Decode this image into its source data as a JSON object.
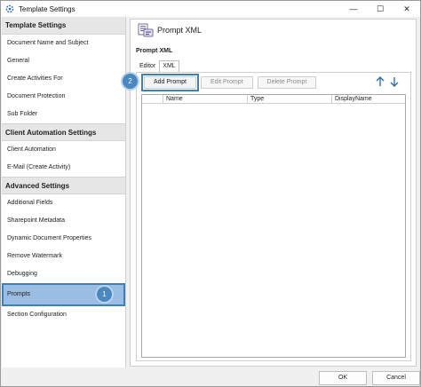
{
  "window": {
    "title": "Template Settings",
    "minimize": "—",
    "maximize": "☐",
    "close": "✕"
  },
  "sidebar": {
    "template_settings": {
      "header": "Template Settings",
      "items": [
        "Document Name and Subject",
        "General",
        "Create Activities For",
        "Document Protection",
        "Sub Folder"
      ]
    },
    "client_automation": {
      "header": "Client Automation Settings",
      "items": [
        "Client Automation",
        "E-Mail (Create Activity)"
      ]
    },
    "advanced": {
      "header": "Advanced Settings",
      "items": [
        "Additional Fields",
        "Sharepoint Metadata",
        "Dynamic Document Properties",
        "Remove Watermark",
        "Debugging",
        "Prompts",
        "Section Configuration"
      ]
    },
    "selected": "Prompts"
  },
  "badges": {
    "one": "1",
    "two": "2"
  },
  "main": {
    "title": "Prompt XML",
    "section_label": "Prompt XML",
    "tabs": [
      "Editor",
      "XML"
    ],
    "toolbar": {
      "add": "Add Prompt",
      "edit": "Edit Prompt",
      "delete": "Delete Prompt"
    },
    "arrows": {
      "up": "↑",
      "down": "↓"
    },
    "columns": [
      "",
      "Name",
      "Type",
      "DisplayName"
    ]
  },
  "footer": {
    "ok": "OK",
    "cancel": "Cancel"
  },
  "colors": {
    "accent": "#3f7fb6",
    "selected": "#9bbde3",
    "badge": "#4a88c2"
  }
}
